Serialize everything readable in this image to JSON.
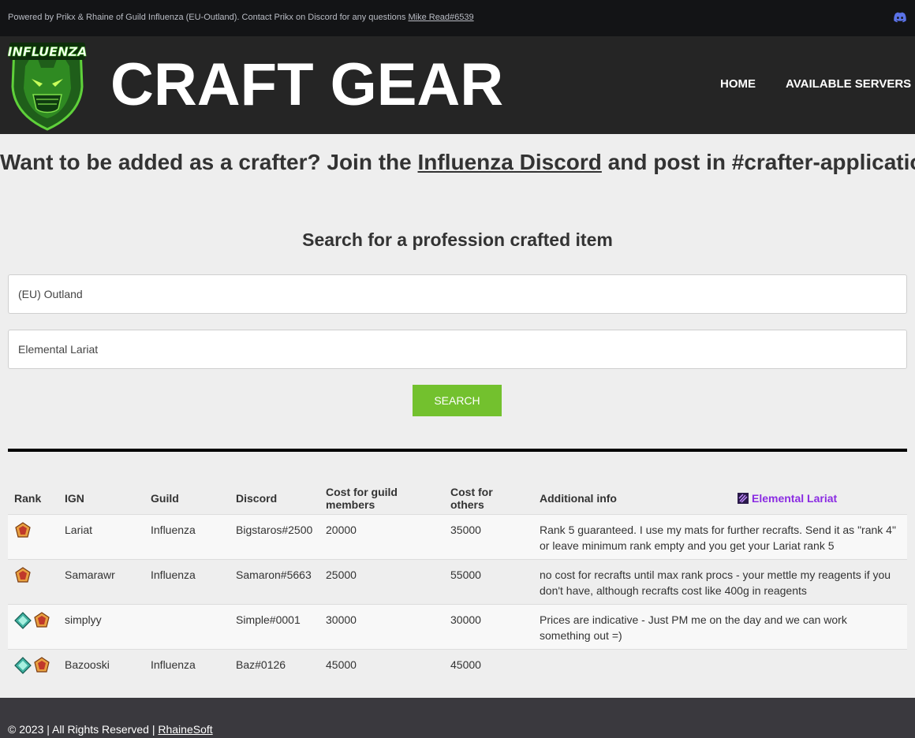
{
  "topbar": {
    "powered_text": "Powered by Prikx & Rhaine of Guild Influenza (EU-Outland). Contact Prikx on Discord for any questions",
    "contact_link": "Mike Read#6539",
    "discord_icon": "discord-icon"
  },
  "header": {
    "logo_text": "INFLUENZA",
    "title": "CRAFT GEAR",
    "nav": {
      "home": "HOME",
      "servers": "AVAILABLE SERVERS"
    }
  },
  "banner": {
    "prefix": "Want to be added as a crafter? Join the",
    "link": "Influenza Discord",
    "suffix": "and post in #crafter-application."
  },
  "search": {
    "heading": "Search for a profession crafted item",
    "server_value": "(EU) Outland",
    "item_value": "Elemental Lariat",
    "button": "SEARCH"
  },
  "results": {
    "headers": {
      "rank": "Rank",
      "ign": "IGN",
      "guild": "Guild",
      "discord": "Discord",
      "cost_guild": "Cost for guild members",
      "cost_others": "Cost for others",
      "info": "Additional info",
      "item": "Elemental Lariat"
    },
    "rows": [
      {
        "ign": "Lariat",
        "guild": "Influenza",
        "discord": "Bigstaros#2500",
        "cost_guild": "20000",
        "cost_others": "35000",
        "info": "Rank 5 guaranteed. I use my mats for further recrafts. Send it as \"rank 4\" or leave minimum rank empty and you get your Lariat rank 5"
      },
      {
        "ign": "Samarawr",
        "guild": "Influenza",
        "discord": "Samaron#5663",
        "cost_guild": "25000",
        "cost_others": "55000",
        "info": "no cost for recrafts until max rank procs - your mettle my reagents if you don't have, although recrafts cost like 400g in reagents"
      },
      {
        "ign": "simplyy",
        "guild": "",
        "discord": "Simple#0001",
        "cost_guild": "30000",
        "cost_others": "30000",
        "info": "Prices are indicative - Just PM me on the day and we can work something out =)"
      },
      {
        "ign": "Bazooski",
        "guild": "Influenza",
        "discord": "Baz#0126",
        "cost_guild": "45000",
        "cost_others": "45000",
        "info": ""
      }
    ]
  },
  "footer": {
    "copy": "© 2023 | All Rights Reserved |",
    "link": "RhaineSoft"
  },
  "colors": {
    "topbar_bg": "#131416",
    "header_bg": "#252525",
    "page_bg": "#eeeeee",
    "search_button": "#73c12e",
    "item_link": "#8a2be2",
    "footer_bg": "#3a393e"
  }
}
